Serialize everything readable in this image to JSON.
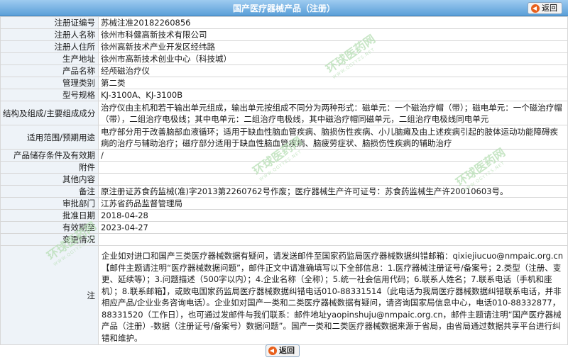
{
  "header": {
    "title": "国产医疗器械产品（注册）",
    "back_label": "返回"
  },
  "rows": [
    {
      "label": "注册证编号",
      "value": "苏械注准20182260856"
    },
    {
      "label": "注册人名称",
      "value": "徐州市科健高新技术有限公司"
    },
    {
      "label": "注册人住所",
      "value": "徐州高新技术产业开发区经纬路"
    },
    {
      "label": "生产地址",
      "value": "徐州市高新技术创业中心（科技城）"
    },
    {
      "label": "产品名称",
      "value": "经颅磁治疗仪"
    },
    {
      "label": "管理类别",
      "value": "第二类"
    },
    {
      "label": "型号规格",
      "value": "KJ-3100A、KJ-3100B"
    },
    {
      "label": "结构及组成/主要组成成分",
      "value": "治疗仪由主机和若干输出单元组成，输出单元按组成不同分为两种形式：磁单元：一个磁治疗帽（带）；磁电单元：一个磁治疗帽（带），二组治疗电极线；其中电单元：二组治疗电极线，其中磁治疗帽同磁单元，二组治疗电极线同电单元"
    },
    {
      "label": "适用范围/预期用途",
      "value": "电疗部分用于改善脑部血液循环；适用于缺血性脑血管疾病、脑损伤性疾病、小儿脑瘫及由上述疾病引起的肢体运动功能障碍疾病的治疗与辅助治疗；磁疗部分适用于缺血性脑血管疾病、脑疲劳症状、脑损伤性疾病的辅助治疗"
    },
    {
      "label": "产品储存条件及有效期",
      "value": "/"
    },
    {
      "label": "附件",
      "value": ""
    },
    {
      "label": "其他内容",
      "value": ""
    },
    {
      "label": "备注",
      "value": "原注册证苏食药监械(准)字2013第2260762号作废；医疗器械生产许可证号：苏食药监械生产许20010603号。"
    },
    {
      "label": "审批部门",
      "value": "江苏省药品监督管理局"
    },
    {
      "label": "批准日期",
      "value": "2018-04-28"
    },
    {
      "label": "有效期至",
      "value": "2023-04-27"
    },
    {
      "label": "变更情况",
      "value": ""
    }
  ],
  "note": {
    "label": "注",
    "text": "企业如对进口和国产三类医疗器械数据有疑问，请发送邮件至国家药监局医疗器械数据纠错邮箱：qixiejiucuo@nmpaic.org.cn【邮件主题请注明“医疗器械数据问题”，邮件正文中请准确填写以下全部信息：1.医疗器械注册证号/备案号；2.类型（注册、变更、延续等）；3.问题描述（500字以内）；4.企业名称（全称）；5.统一社会信用代码；6.联系人姓名；7.联系电话（手机和座机）；8.联系邮箱】，或致电国家药监局医疗器械数据纠错电话010-88331514（此电话为我局医疗器械数据纠错联系电话，并非相应产品/企业业务咨询电话）。企业如对国产一类和二类医疗器械数据有疑问，请咨询国家局信息中心，电话010-88332877，88331520（工作日），也可通过发邮件与我们联系：邮件地址yaopinshuju@nmpaic.org.cn，邮件主题请注明“国产医疗器械产品（注册）-数据（注册证号/备案号）数据问题”。国产一类和二类医疗器械数据来源于省局，由省局通过数据共享平台进行纠错和维护。"
  },
  "watermark": {
    "text": "环球医药网",
    "sub": "WWW.QGYYZS.NET"
  },
  "footer": {
    "back_label": "返回"
  }
}
